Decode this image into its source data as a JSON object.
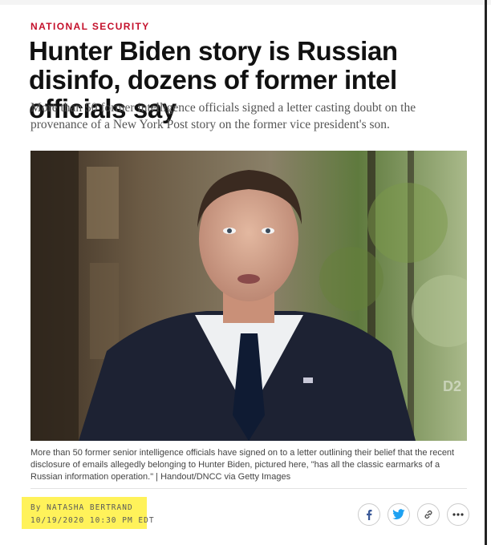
{
  "article": {
    "kicker": "NATIONAL SECURITY",
    "headline": "Hunter Biden story is Russian disinfo, dozens of former intel officials say",
    "dek": "More than 50 former intelligence officials signed a letter casting doubt on the provenance of a New York Post story on the former vice president's son.",
    "photo": {
      "caption": "More than 50 former senior intelligence officials have signed on to a letter outlining their belief that the recent disclosure of emails allegedly belonging to Hunter Biden, pictured here, \"has all the classic earmarks of a Russian information operation.\" | Handout/DNCC via Getty Images",
      "watermark": "D2"
    },
    "byline": {
      "author_line": "By NATASHA BERTRAND",
      "timestamp": "10/19/2020 10:30 PM EDT"
    }
  },
  "share": {
    "items": [
      {
        "icon": "facebook-icon",
        "color": "#3b5998"
      },
      {
        "icon": "twitter-icon",
        "color": "#1da1f2"
      },
      {
        "icon": "link-icon",
        "color": "#555555"
      },
      {
        "icon": "more-icon",
        "color": "#333333"
      }
    ]
  },
  "colors": {
    "kicker": "#c4102b",
    "highlight": "#fff25a"
  }
}
